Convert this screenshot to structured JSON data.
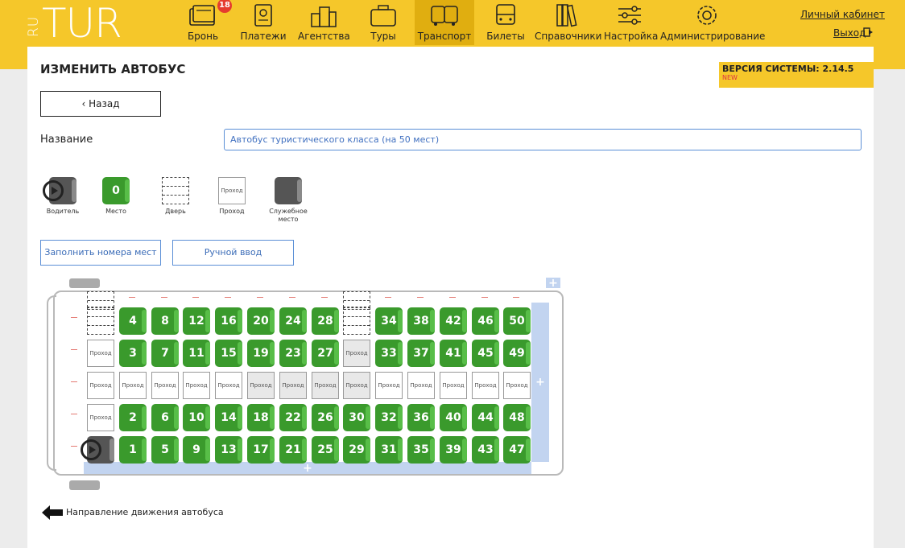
{
  "header": {
    "logo_ru": "RU",
    "logo_tur": "TUR",
    "nav": [
      {
        "label": "Бронь",
        "icon": "tickets-icon",
        "badge": "18"
      },
      {
        "label": "Платежи",
        "icon": "payments-icon"
      },
      {
        "label": "Агентства",
        "icon": "agencies-icon"
      },
      {
        "label": "Туры",
        "icon": "suitcase-icon"
      },
      {
        "label": "Транспорт",
        "icon": "bus-icon",
        "active": true
      },
      {
        "label": "Билеты",
        "icon": "bus-front-icon"
      },
      {
        "label": "Справочники",
        "icon": "books-icon"
      },
      {
        "label": "Настройка",
        "icon": "sliders-icon"
      },
      {
        "label": "Администрирование",
        "icon": "gear-icon"
      }
    ],
    "account_link": "Личный кабинет",
    "logout_link": "Выход"
  },
  "page": {
    "title": "ИЗМЕНИТЬ АВТОБУС",
    "version_label": "ВЕРСИЯ СИСТЕМЫ: 2.14.5",
    "version_new": "NEW",
    "back_label": "Назад",
    "name_label": "Название",
    "name_value": "Автобус туристического класса (на 50 мест)"
  },
  "legend": [
    {
      "type": "driver",
      "label": "Водитель"
    },
    {
      "type": "seat",
      "label": "Место",
      "value": "0"
    },
    {
      "type": "door",
      "label": "Дверь"
    },
    {
      "type": "aisle",
      "label": "Проход",
      "value": "Проход"
    },
    {
      "type": "service",
      "label": "Служебное место"
    }
  ],
  "buttons": {
    "fill_numbers": "Заполнить номера мест",
    "manual_input": "Ручной ввод"
  },
  "bus_layout": {
    "aisle_text": "Проход",
    "rows": [
      [
        "door",
        "4",
        "8",
        "12",
        "16",
        "20",
        "24",
        "28",
        "door",
        "34",
        "38",
        "42",
        "46",
        "50"
      ],
      [
        "aisle",
        "3",
        "7",
        "11",
        "15",
        "19",
        "23",
        "27",
        "aisle-shaded",
        "33",
        "37",
        "41",
        "45",
        "49"
      ],
      [
        "aisle",
        "aisle",
        "aisle",
        "aisle",
        "aisle",
        "aisle-shaded",
        "aisle-shaded",
        "aisle-shaded",
        "aisle-shaded",
        "aisle",
        "aisle",
        "aisle",
        "aisle",
        "aisle"
      ],
      [
        "aisle",
        "2",
        "6",
        "10",
        "14",
        "18",
        "22",
        "26",
        "30",
        "32",
        "36",
        "40",
        "44",
        "48"
      ],
      [
        "driver",
        "1",
        "5",
        "9",
        "13",
        "17",
        "21",
        "25",
        "29",
        "31",
        "35",
        "39",
        "43",
        "47"
      ]
    ]
  },
  "direction_label": "Направление движения автобуса",
  "colors": {
    "accent": "#f5c72a",
    "seat": "#3a9a2c",
    "link_blue": "#3c6db8"
  }
}
